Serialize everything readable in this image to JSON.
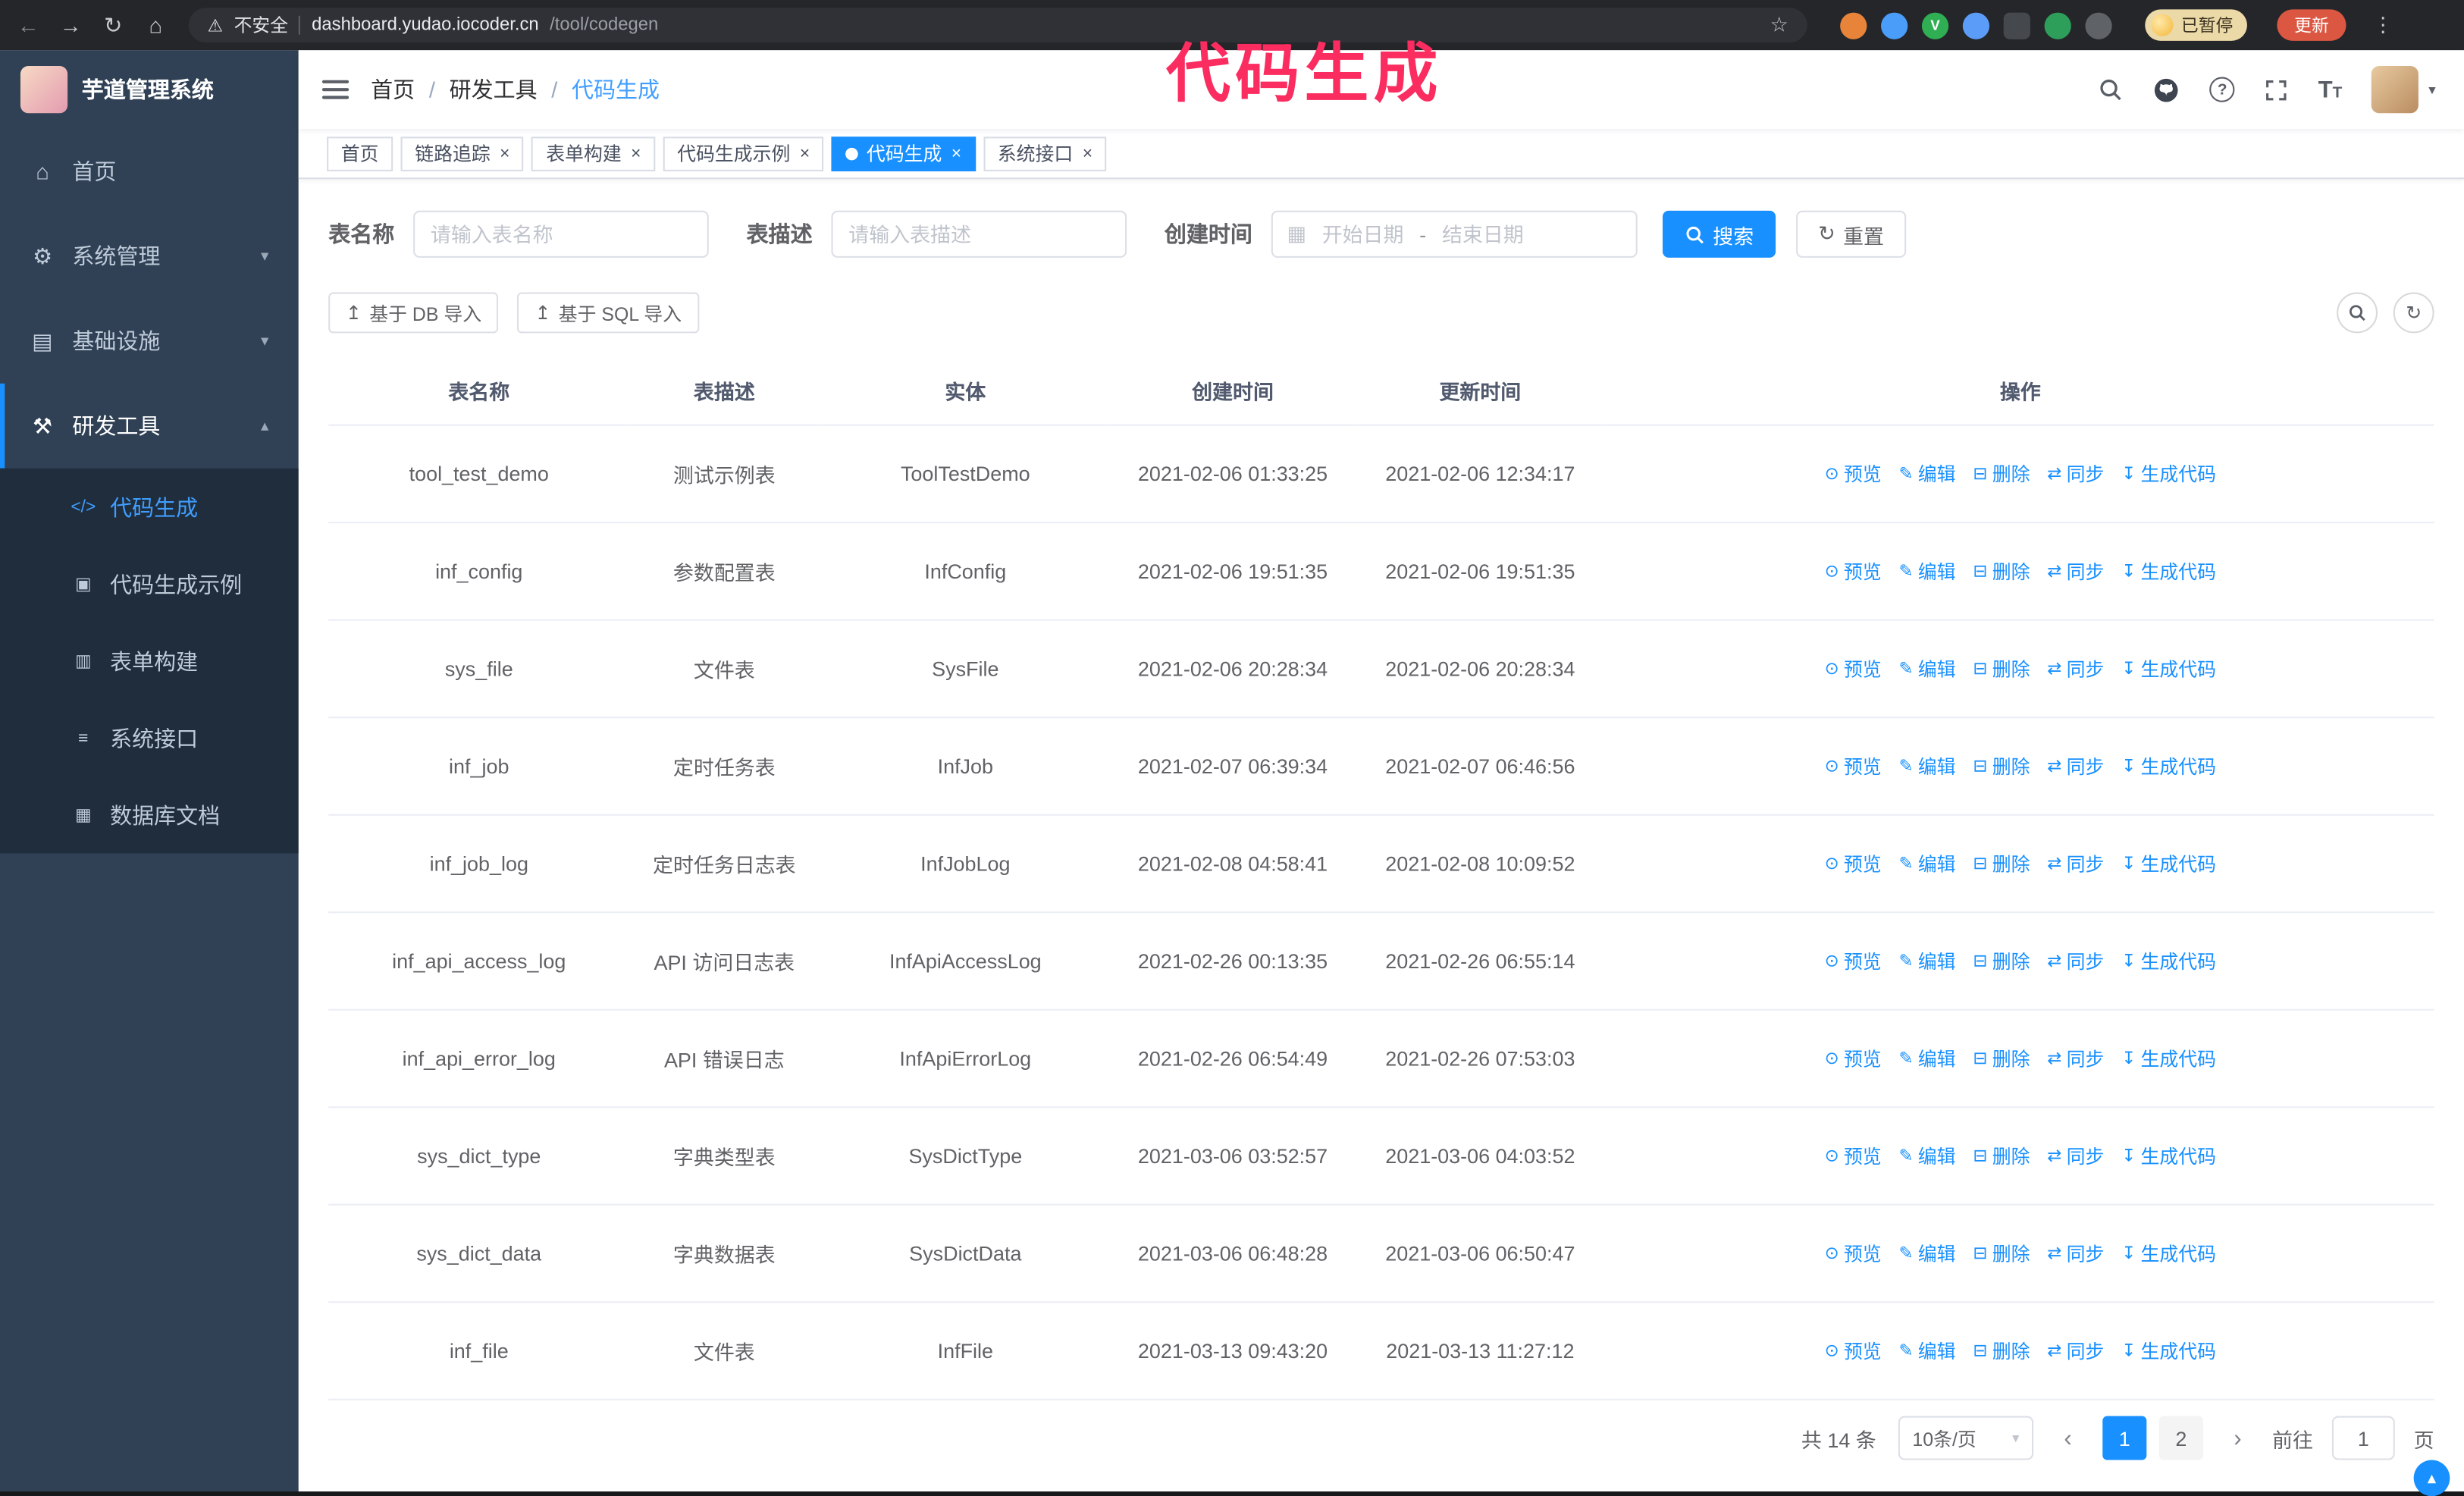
{
  "annotation": {
    "text": "代码生成"
  },
  "browser": {
    "security_label": "不安全",
    "url_host": "dashboard.yudao.iocoder.cn",
    "url_path": "/tool/codegen",
    "paused_badge": "已暂停",
    "update_button": "更新"
  },
  "sidebar": {
    "logo_title": "芋道管理系统",
    "items": [
      {
        "label": "首页"
      },
      {
        "label": "系统管理"
      },
      {
        "label": "基础设施"
      },
      {
        "label": "研发工具"
      }
    ],
    "subitems": [
      {
        "label": "代码生成",
        "active": true
      },
      {
        "label": "代码生成示例"
      },
      {
        "label": "表单构建"
      },
      {
        "label": "系统接口"
      },
      {
        "label": "数据库文档"
      }
    ]
  },
  "header": {
    "breadcrumb": [
      "首页",
      "研发工具",
      "代码生成"
    ],
    "separator": "/"
  },
  "tabs": [
    {
      "label": "首页",
      "closable": false
    },
    {
      "label": "链路追踪",
      "closable": true
    },
    {
      "label": "表单构建",
      "closable": true
    },
    {
      "label": "代码生成示例",
      "closable": true
    },
    {
      "label": "代码生成",
      "closable": true,
      "active": true
    },
    {
      "label": "系统接口",
      "closable": true
    }
  ],
  "filters": {
    "table_name_label": "表名称",
    "table_name_placeholder": "请输入表名称",
    "table_desc_label": "表描述",
    "table_desc_placeholder": "请输入表描述",
    "create_time_label": "创建时间",
    "date_start_placeholder": "开始日期",
    "date_separator": "-",
    "date_end_placeholder": "结束日期",
    "search_button": "搜索",
    "reset_button": "重置"
  },
  "toolbar": {
    "import_db_button": "基于 DB 导入",
    "import_sql_button": "基于 SQL 导入"
  },
  "table": {
    "columns": [
      "表名称",
      "表描述",
      "实体",
      "创建时间",
      "更新时间",
      "操作"
    ],
    "actions": [
      "预览",
      "编辑",
      "删除",
      "同步",
      "生成代码"
    ],
    "rows": [
      {
        "name": "tool_test_demo",
        "desc": "测试示例表",
        "entity": "ToolTestDemo",
        "created": "2021-02-06 01:33:25",
        "updated": "2021-02-06 12:34:17"
      },
      {
        "name": "inf_config",
        "desc": "参数配置表",
        "entity": "InfConfig",
        "created": "2021-02-06 19:51:35",
        "updated": "2021-02-06 19:51:35"
      },
      {
        "name": "sys_file",
        "desc": "文件表",
        "entity": "SysFile",
        "created": "2021-02-06 20:28:34",
        "updated": "2021-02-06 20:28:34"
      },
      {
        "name": "inf_job",
        "desc": "定时任务表",
        "entity": "InfJob",
        "created": "2021-02-07 06:39:34",
        "updated": "2021-02-07 06:46:56"
      },
      {
        "name": "inf_job_log",
        "desc": "定时任务日志表",
        "entity": "InfJobLog",
        "created": "2021-02-08 04:58:41",
        "updated": "2021-02-08 10:09:52"
      },
      {
        "name": "inf_api_access_log",
        "desc": "API 访问日志表",
        "entity": "InfApiAccessLog",
        "created": "2021-02-26 00:13:35",
        "updated": "2021-02-26 06:55:14"
      },
      {
        "name": "inf_api_error_log",
        "desc": "API 错误日志",
        "entity": "InfApiErrorLog",
        "created": "2021-02-26 06:54:49",
        "updated": "2021-02-26 07:53:03"
      },
      {
        "name": "sys_dict_type",
        "desc": "字典类型表",
        "entity": "SysDictType",
        "created": "2021-03-06 03:52:57",
        "updated": "2021-03-06 04:03:52"
      },
      {
        "name": "sys_dict_data",
        "desc": "字典数据表",
        "entity": "SysDictData",
        "created": "2021-03-06 06:48:28",
        "updated": "2021-03-06 06:50:47"
      },
      {
        "name": "inf_file",
        "desc": "文件表",
        "entity": "InfFile",
        "created": "2021-03-13 09:43:20",
        "updated": "2021-03-13 11:27:12"
      }
    ]
  },
  "pagination": {
    "total": "共 14 条",
    "page_size": "10条/页",
    "pages": [
      "1",
      "2"
    ],
    "active_page": "1",
    "goto_label": "前往",
    "goto_value": "1",
    "goto_suffix": "页"
  },
  "icons": {
    "back": "←",
    "forward": "→",
    "reload": "↻",
    "home": "⌂",
    "warning": "⚠",
    "star": "☆",
    "kebab": "⋮",
    "close": "×",
    "chevron_down": "▾",
    "chevron_up": "▴",
    "caret_down": "▾",
    "menu_home": "⌂",
    "menu_system": "⚙",
    "menu_infra": "▤",
    "menu_dev": "⚒",
    "sub_codegen": "</>",
    "sub_example": "▣",
    "sub_form": "▥",
    "sub_api": "≡",
    "sub_db": "▦",
    "calendar": "▦",
    "refresh": "↻",
    "upload": "↥",
    "op_preview": "⊙",
    "op_edit": "✎",
    "op_delete": "⊟",
    "op_sync": "⇄",
    "op_generate": "↧",
    "arrow_left": "‹",
    "arrow_right": "›",
    "question": "?",
    "divider": "|",
    "up": "▴"
  },
  "colors": {
    "primary": "#1890ff",
    "active_text": "#409eff",
    "sidebar_bg": "#304156",
    "submenu_bg": "#1f2d3d",
    "chrome_bg": "#25262a",
    "update_button": "#dc5742",
    "annotation": "#fb2c5f"
  }
}
